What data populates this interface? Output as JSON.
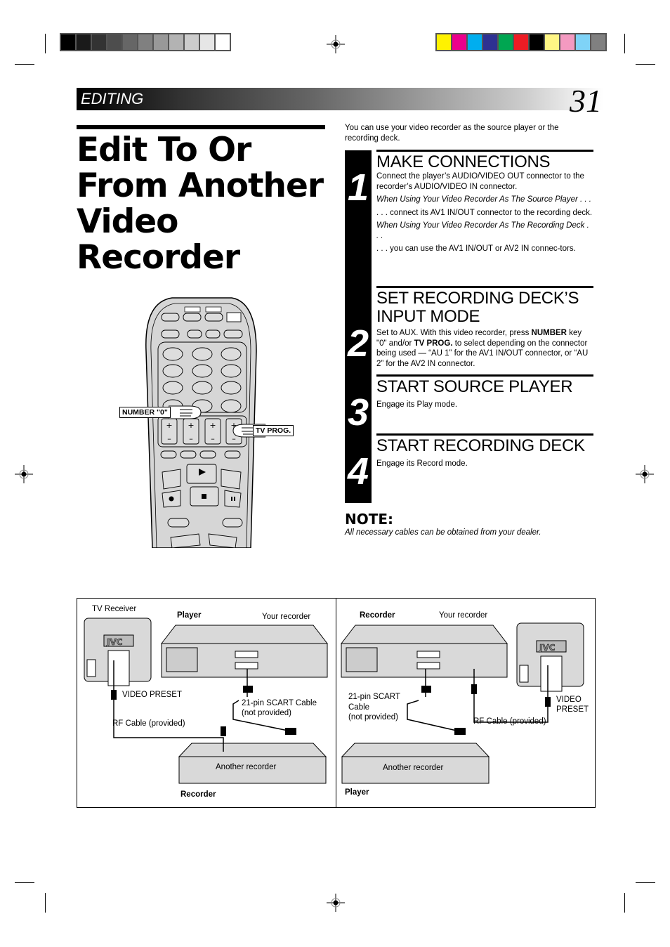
{
  "header": {
    "section_label": "EDITING",
    "page_number": "31"
  },
  "color_bars": {
    "grayscale": [
      "#000000",
      "#1a1a1a",
      "#333333",
      "#4d4d4d",
      "#666666",
      "#808080",
      "#999999",
      "#b3b3b3",
      "#cccccc",
      "#e6e6e6",
      "#ffffff"
    ],
    "process": [
      "#fff200",
      "#ec008c",
      "#00aeef",
      "#2e3192",
      "#00a651",
      "#ed1c24",
      "#000000",
      "#fff685",
      "#f49ac1",
      "#7fd3f7",
      "#808080"
    ]
  },
  "title": {
    "lines": [
      "Edit To Or",
      "From Another",
      "Video",
      "Recorder"
    ]
  },
  "intro": "You can use your video recorder as the source player or the recording deck.",
  "steps": [
    {
      "number": "1",
      "title": "MAKE CONNECTIONS",
      "paragraphs": [
        {
          "text": "Connect the player’s AUDIO/VIDEO OUT connector to the recorder’s AUDIO/VIDEO IN connector.",
          "italic": false
        },
        {
          "text": "When Using Your Video Recorder As The Source Player . . .",
          "italic": true
        },
        {
          "text": ". . . connect its AV1 IN/OUT connector to the recording deck.",
          "italic": false
        },
        {
          "text": "When Using Your Video Recorder As The Recording Deck . . .",
          "italic": true
        },
        {
          "text": " . . . you can use the AV1 IN/OUT or AV2 IN connec-tors.",
          "italic": false
        }
      ]
    },
    {
      "number": "2",
      "title_line1": "SET RECORDING DECK’S",
      "title_line2": "INPUT MODE",
      "body_pre": "Set to AUX. With this video recorder, press ",
      "body_bold1": "NUMBER",
      "body_mid": " key \"0\" and/or ",
      "body_bold2": "TV PROG.",
      "body_post": " to select depending on the connector being used — “AU 1” for the AV1 IN/OUT connector, or “AU 2” for the AV2 IN connector."
    },
    {
      "number": "3",
      "title": "START SOURCE PLAYER",
      "body": "Engage its Play mode."
    },
    {
      "number": "4",
      "title": "START RECORDING DECK",
      "body": "Engage its Record mode."
    }
  ],
  "note": {
    "title": "NOTE:",
    "text": "All necessary cables can be obtained from your dealer."
  },
  "remote": {
    "callout_number": "NUMBER \"0\"",
    "callout_tvprog": "TV PROG."
  },
  "diagram": {
    "left": {
      "tv_label": "TV Receiver",
      "role_top": "Player",
      "your_recorder": "Your recorder",
      "video_preset": "VIDEO PRESET",
      "scart_line1": "21-pin SCART Cable",
      "scart_line2": "(not provided)",
      "rf_cable": "RF Cable (provided)",
      "another_recorder": "Another recorder",
      "role_bottom": "Recorder"
    },
    "right": {
      "role_top": "Recorder",
      "your_recorder": "Your recorder",
      "scart_line1": "21-pin SCART",
      "scart_line2": "Cable",
      "scart_line3": "(not provided)",
      "video_preset_line1": "VIDEO",
      "video_preset_line2": "PRESET",
      "rf_cable": "RF Cable (provided)",
      "another_recorder": "Another recorder",
      "role_bottom": "Player"
    },
    "tv_brand": "JVC"
  }
}
